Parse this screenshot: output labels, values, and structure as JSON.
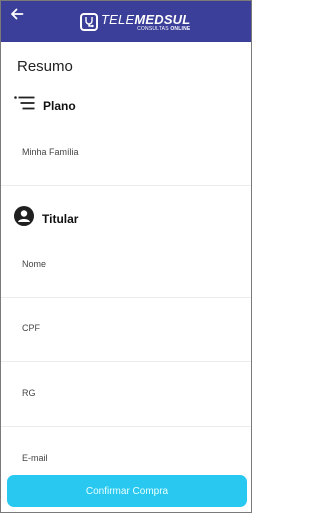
{
  "header": {
    "back_icon": "arrow-left-icon",
    "logo": {
      "part1": "TELE",
      "part2": "MEDSUL",
      "sub1": "CONSULTAS",
      "sub2": "ONLINE"
    },
    "colors": {
      "bar": "#3b3f99"
    }
  },
  "page": {
    "title": "Resumo"
  },
  "plano": {
    "icon": "list-icon",
    "title": "Plano",
    "value": "Minha Família"
  },
  "titular": {
    "icon": "person-circle-icon",
    "title": "Titular",
    "fields": [
      {
        "label": "Nome"
      },
      {
        "label": "CPF"
      },
      {
        "label": "RG"
      },
      {
        "label": "E-mail"
      }
    ]
  },
  "actions": {
    "confirm_label": "Confirmar Compra",
    "confirm_color": "#29c8f0"
  }
}
